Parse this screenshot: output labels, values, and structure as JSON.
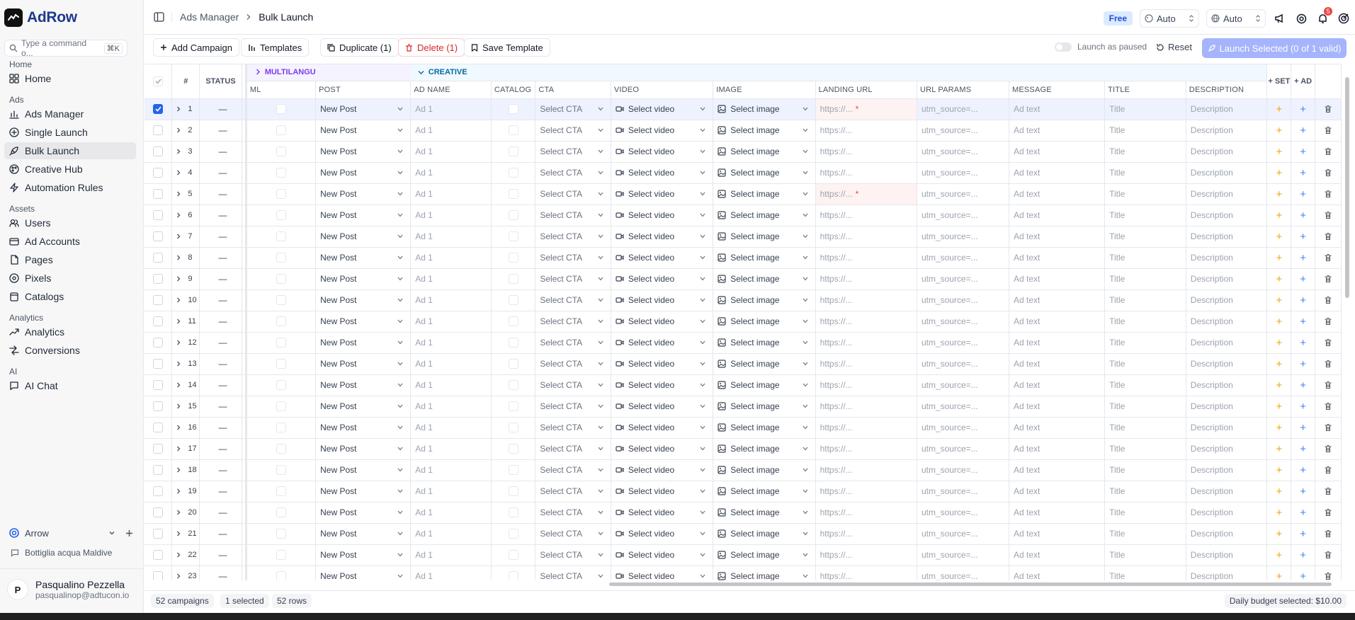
{
  "app": {
    "name": "AdRow"
  },
  "command": {
    "placeholder": "Type a command o...",
    "shortcut": "⌘K"
  },
  "nav": [
    {
      "section": "Home",
      "items": [
        {
          "label": "Home",
          "icon": "grid-icon"
        }
      ]
    },
    {
      "section": "Ads",
      "items": [
        {
          "label": "Ads Manager",
          "icon": "bar-chart-icon"
        },
        {
          "label": "Single Launch",
          "icon": "plus-circle-icon"
        },
        {
          "label": "Bulk Launch",
          "icon": "rocket-icon",
          "active": true
        },
        {
          "label": "Creative Hub",
          "icon": "palette-icon"
        },
        {
          "label": "Automation Rules",
          "icon": "zap-icon"
        }
      ]
    },
    {
      "section": "Assets",
      "items": [
        {
          "label": "Users",
          "icon": "users-icon"
        },
        {
          "label": "Ad Accounts",
          "icon": "wallet-icon"
        },
        {
          "label": "Pages",
          "icon": "file-icon"
        },
        {
          "label": "Pixels",
          "icon": "pixel-icon"
        },
        {
          "label": "Catalogs",
          "icon": "catalog-icon"
        }
      ]
    },
    {
      "section": "Analytics",
      "items": [
        {
          "label": "Analytics",
          "icon": "trend-icon"
        },
        {
          "label": "Conversions",
          "icon": "conversion-icon"
        }
      ]
    },
    {
      "section": "AI",
      "items": [
        {
          "label": "AI Chat",
          "icon": "chat-icon"
        }
      ]
    }
  ],
  "org": {
    "name": "Arrow"
  },
  "project": {
    "name": "Bottiglia acqua Maldive"
  },
  "user": {
    "initial": "P",
    "name": "Pasqualino Pezzella",
    "email": "pasqualinop@adtucon.io"
  },
  "header": {
    "breadcrumb": [
      "Ads Manager",
      "Bulk Launch"
    ],
    "plan": "Free",
    "select_1": "Auto",
    "select_2": "Auto",
    "notifications": "5"
  },
  "toolbar": {
    "add_campaign": "Add Campaign",
    "templates": "Templates",
    "duplicate": "Duplicate (1)",
    "delete": "Delete (1)",
    "save_template": "Save Template",
    "launch_paused": "Launch as paused",
    "reset": "Reset",
    "launch": "Launch Selected (0 of 1 valid)"
  },
  "groups": {
    "multilanguage": "MULTILANGU",
    "creative": "CREATIVE"
  },
  "columns": {
    "num": "#",
    "status": "STATUS",
    "ml": "ML",
    "post": "POST",
    "ad_name": "AD NAME",
    "catalog": "CATALOG",
    "cta": "CTA",
    "video": "VIDEO",
    "image": "IMAGE",
    "landing_url": "LANDING URL",
    "url_params": "URL PARAMS",
    "message": "MESSAGE",
    "title": "TITLE",
    "description": "DESCRIPTION",
    "add_set": "+ SET",
    "add_ad": "+ AD"
  },
  "cell_defaults": {
    "status": "—",
    "post": "New Post",
    "ad_name": "Ad 1",
    "cta": "Select CTA",
    "video": "Select video",
    "image": "Select image",
    "landing_url": "https://...",
    "url_params": "utm_source=...",
    "message": "Ad text",
    "title": "Title",
    "description": "Description",
    "add": "+"
  },
  "rows": [
    {
      "num": "1",
      "selected": true,
      "url_error": true
    },
    {
      "num": "2"
    },
    {
      "num": "3"
    },
    {
      "num": "4"
    },
    {
      "num": "5",
      "url_error": true
    },
    {
      "num": "6"
    },
    {
      "num": "7"
    },
    {
      "num": "8"
    },
    {
      "num": "9"
    },
    {
      "num": "10"
    },
    {
      "num": "11"
    },
    {
      "num": "12"
    },
    {
      "num": "13"
    },
    {
      "num": "14"
    },
    {
      "num": "15"
    },
    {
      "num": "16"
    },
    {
      "num": "17"
    },
    {
      "num": "18"
    },
    {
      "num": "19"
    },
    {
      "num": "20"
    },
    {
      "num": "21"
    },
    {
      "num": "22"
    },
    {
      "num": "23"
    }
  ],
  "footer": {
    "campaigns": "52 campaigns",
    "selected": "1 selected",
    "rows": "52 rows",
    "budget": "Daily budget selected: $10.00"
  },
  "colors": {
    "accent": "#2563eb",
    "launch": "#a5b4fc",
    "danger": "#dc2626",
    "add_set": "#f59e0b",
    "add_ad": "#3b82f6"
  }
}
